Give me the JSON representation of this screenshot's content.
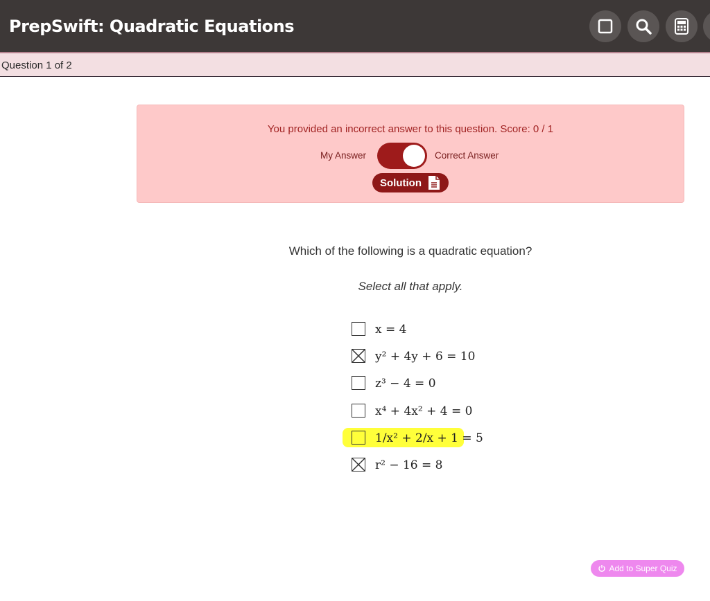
{
  "header": {
    "title": "PrepSwift: Quadratic Equations",
    "tools": [
      {
        "name": "square-icon"
      },
      {
        "name": "search-icon"
      },
      {
        "name": "calculator-icon"
      }
    ],
    "bg_color": "#3d3837"
  },
  "question_bar": {
    "label": "Question 1 of 2"
  },
  "feedback": {
    "message": "You provided an incorrect answer to this question. Score: 0 / 1",
    "toggle_left_label": "My Answer",
    "toggle_right_label": "Correct Answer",
    "solution_label": "Solution",
    "bg_color": "#fec9c9",
    "accent_color": "#9e1b1b"
  },
  "question": {
    "prompt": "Which of the following is a quadratic equation?",
    "instruction": "Select all that apply.",
    "choices": [
      {
        "label": "x = 4",
        "checked": false,
        "highlighted": false
      },
      {
        "label": "y² + 4y + 6 = 10",
        "checked": true,
        "highlighted": false
      },
      {
        "label": "z³ − 4 = 0",
        "checked": false,
        "highlighted": false
      },
      {
        "label": "x⁴ + 4x² + 4 = 0",
        "checked": false,
        "highlighted": false
      },
      {
        "label": "1/x² + 2/x + 1 = 5",
        "checked": false,
        "highlighted": true
      },
      {
        "label": "r² − 16 = 8",
        "checked": true,
        "highlighted": false
      }
    ]
  },
  "footer": {
    "super_quiz_label": "Add to Super Quiz",
    "accent_color": "#ee88ee"
  }
}
